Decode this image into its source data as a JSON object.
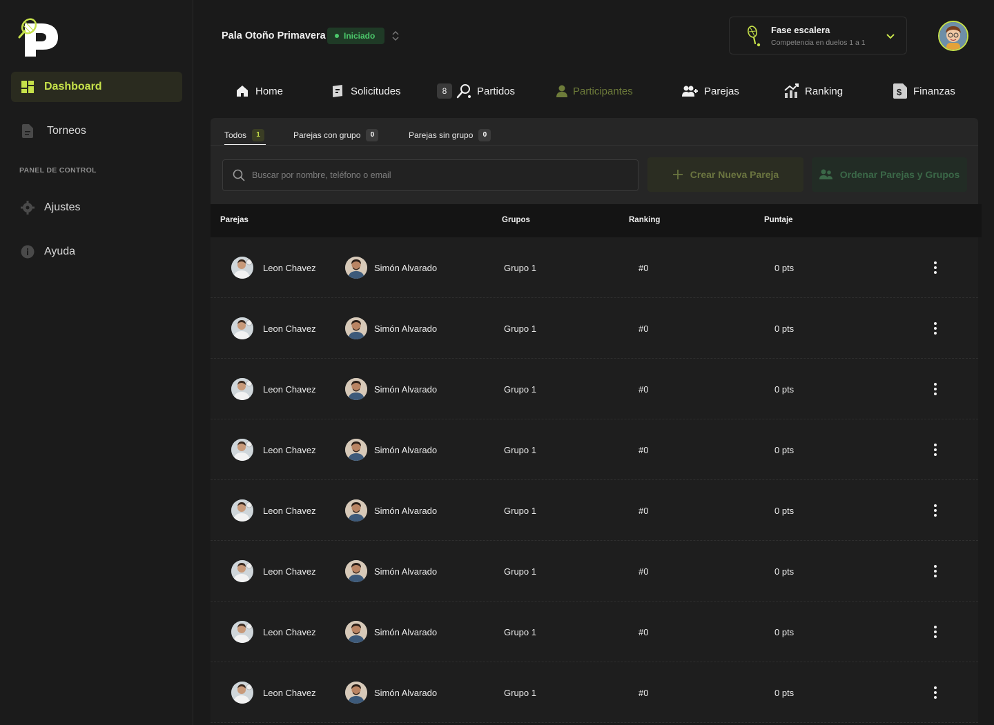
{
  "sidebar": {
    "items": [
      {
        "label": "Dashboard",
        "active": true,
        "icon": "dashboard-grid-icon"
      },
      {
        "label": "Torneos",
        "active": false,
        "icon": "document-icon"
      }
    ],
    "section_title": "PANEL DE CONTROL",
    "control_items": [
      {
        "label": "Ajustes",
        "icon": "gear-icon"
      },
      {
        "label": "Ayuda",
        "icon": "info-icon"
      }
    ]
  },
  "header": {
    "tournament_name": "Pala Otoño Primavera",
    "status": "Iniciado",
    "phase_title": "Fase escalera",
    "phase_subtitle": "Competencia en duelos  1 a 1"
  },
  "tabs": [
    {
      "label": "Home",
      "icon": "home-icon"
    },
    {
      "label": "Solicitudes",
      "icon": "requests-icon"
    },
    {
      "label": "Partidos",
      "icon": "racket-icon",
      "count": "8"
    },
    {
      "label": "Participantes",
      "icon": "person-icon",
      "active": true
    },
    {
      "label": "Parejas",
      "icon": "add-people-icon"
    },
    {
      "label": "Ranking",
      "icon": "ranking-chart-icon"
    },
    {
      "label": "Finanzas",
      "icon": "dollar-doc-icon"
    }
  ],
  "subtabs": [
    {
      "label": "Todos",
      "count": "1"
    },
    {
      "label": "Parejas con grupo",
      "count": "0"
    },
    {
      "label": "Parejas sin grupo",
      "count": "0"
    }
  ],
  "search": {
    "placeholder": "Buscar por nombre, teléfono o email"
  },
  "buttons": {
    "create": "Crear Nueva Pareja",
    "order": "Ordenar Parejas y Grupos"
  },
  "table": {
    "headers": [
      "Parejas",
      "Grupos",
      "Ranking",
      "Puntaje"
    ],
    "rows": [
      {
        "p1": "Leon Chavez",
        "p2": "Simón Alvarado",
        "group": "Grupo 1",
        "ranking": "#0",
        "score": "0 pts"
      },
      {
        "p1": "Leon Chavez",
        "p2": "Simón Alvarado",
        "group": "Grupo 1",
        "ranking": "#0",
        "score": "0 pts"
      },
      {
        "p1": "Leon Chavez",
        "p2": "Simón Alvarado",
        "group": "Grupo 1",
        "ranking": "#0",
        "score": "0 pts"
      },
      {
        "p1": "Leon Chavez",
        "p2": "Simón Alvarado",
        "group": "Grupo 1",
        "ranking": "#0",
        "score": "0 pts"
      },
      {
        "p1": "Leon Chavez",
        "p2": "Simón Alvarado",
        "group": "Grupo 1",
        "ranking": "#0",
        "score": "0 pts"
      },
      {
        "p1": "Leon Chavez",
        "p2": "Simón Alvarado",
        "group": "Grupo 1",
        "ranking": "#0",
        "score": "0 pts"
      },
      {
        "p1": "Leon Chavez",
        "p2": "Simón Alvarado",
        "group": "Grupo 1",
        "ranking": "#0",
        "score": "0 pts"
      },
      {
        "p1": "Leon Chavez",
        "p2": "Simón Alvarado",
        "group": "Grupo 1",
        "ranking": "#0",
        "score": "0 pts"
      }
    ]
  },
  "colors": {
    "accent": "#c6e14a",
    "status_green": "#4cc86b",
    "background": "#1a1a1a"
  }
}
